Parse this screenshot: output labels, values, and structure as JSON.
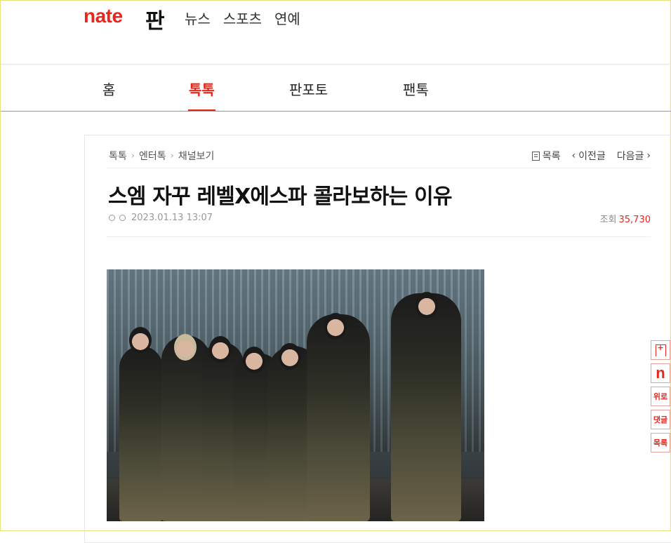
{
  "header": {
    "logo": "nate",
    "service": "판",
    "gnb": [
      "뉴스",
      "스포츠",
      "연예"
    ]
  },
  "subnav": {
    "tabs": [
      "홈",
      "톡톡",
      "판포토",
      "팬톡"
    ],
    "active": "톡톡"
  },
  "article": {
    "breadcrumb": [
      "톡톡",
      "엔터톡",
      "채널보기"
    ],
    "nav": {
      "list": "목록",
      "prev": "이전글",
      "next": "다음글"
    },
    "title": "스엠 자꾸 레벨X에스파 콜라보하는 이유",
    "author_mark": "ㅇㅇ",
    "datetime": "2023.01.13 13:07",
    "views_label": "조회",
    "views": "35,730"
  },
  "side_buttons": {
    "bookmark_icon": "bookmark-plus-icon",
    "nate": "n",
    "top": "위로",
    "comments": "댓글",
    "list": "목록"
  },
  "colors": {
    "accent": "#e8261b"
  }
}
